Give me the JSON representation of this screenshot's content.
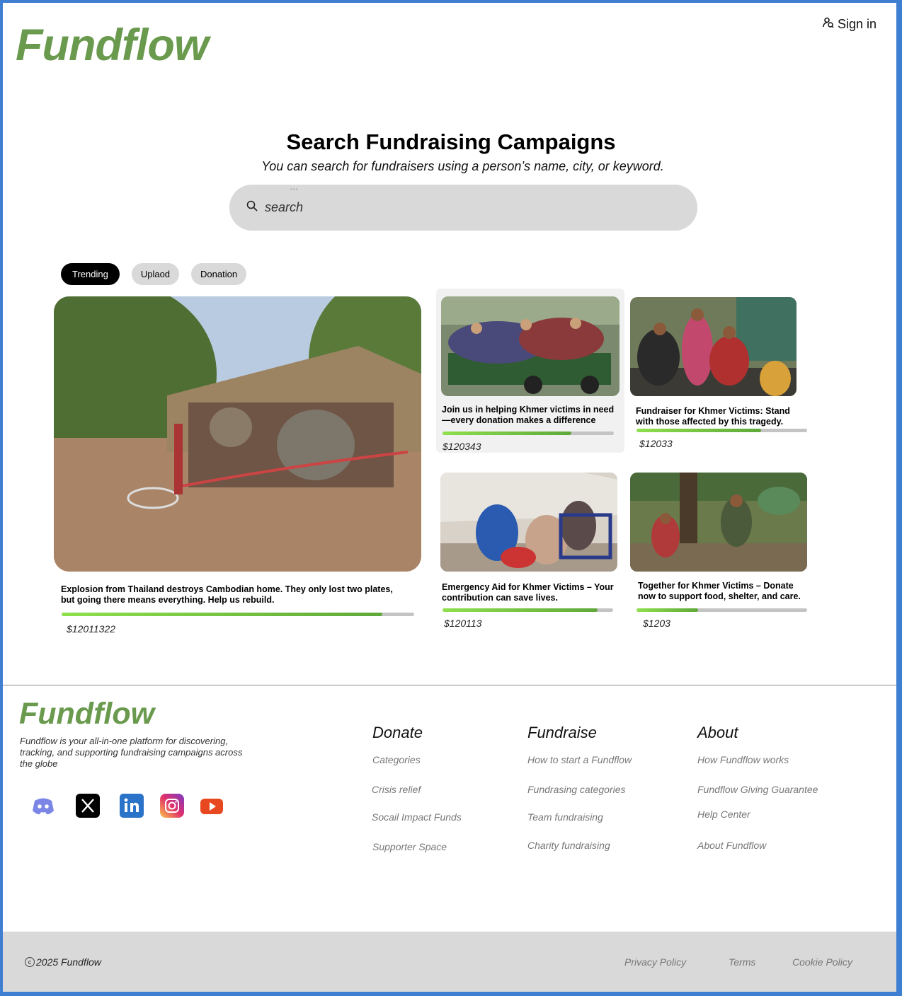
{
  "header": {
    "logo": "Fundflow",
    "signin_label": "Sign in"
  },
  "hero": {
    "title": "Search Fundraising Campaigns",
    "subtitle": "You can search for fundraisers using a person’s name, city, or keyword.",
    "search_placeholder": "search"
  },
  "filters": {
    "tabs": [
      "Trending",
      "Uplaod",
      "Donation"
    ],
    "active": "Trending"
  },
  "campaigns": [
    {
      "title": "Explosion from Thailand destroys Cambodian home. They only lost two plates, but going there means everything. Help us rebuild.",
      "amount": "$12011322",
      "progress": 0.91
    },
    {
      "title": "Join us in helping Khmer victims in need—every donation makes a difference",
      "amount": "$120343",
      "progress": 0.75
    },
    {
      "title": "Fundraiser for Khmer Victims: Stand with those affected by this tragedy.",
      "amount": "$12033",
      "progress": 0.73
    },
    {
      "title": "Emergency Aid for Khmer Victims – Your contribution can save lives.",
      "amount": "$120113",
      "progress": 0.91
    },
    {
      "title": "Together for Khmer Victims – Donate now to support food, shelter, and care.",
      "amount": "$1203",
      "progress": 0.36
    }
  ],
  "footer": {
    "logo": "Fundflow",
    "description": "Fundflow is your all-in-one platform for discovering, tracking, and supporting fundraising campaigns across the globe",
    "social_icons": [
      "discord-icon",
      "x-icon",
      "linkedin-icon",
      "instagram-icon",
      "youtube-icon"
    ],
    "columns": [
      {
        "heading": "Donate",
        "links": [
          "Categories",
          "Crisis relief",
          "Socail Impact Funds",
          "Supporter Space"
        ]
      },
      {
        "heading": "Fundraise",
        "links": [
          "How to start a Fundflow",
          "Fundrasing categories",
          "Team fundraising",
          "Charity fundraising"
        ]
      },
      {
        "heading": "About",
        "links": [
          "How Fundflow works",
          "Fundflow Giving Guarantee",
          "Help Center",
          "About Fundflow"
        ]
      }
    ],
    "copyright": "2025 Fundflow",
    "legal": [
      "Privacy Policy",
      "Terms",
      "Cookie Policy"
    ]
  },
  "colors": {
    "brand_green": "#6a9a4e",
    "progress_green": "#7dcf45",
    "frame_blue": "#3f7fd1"
  }
}
